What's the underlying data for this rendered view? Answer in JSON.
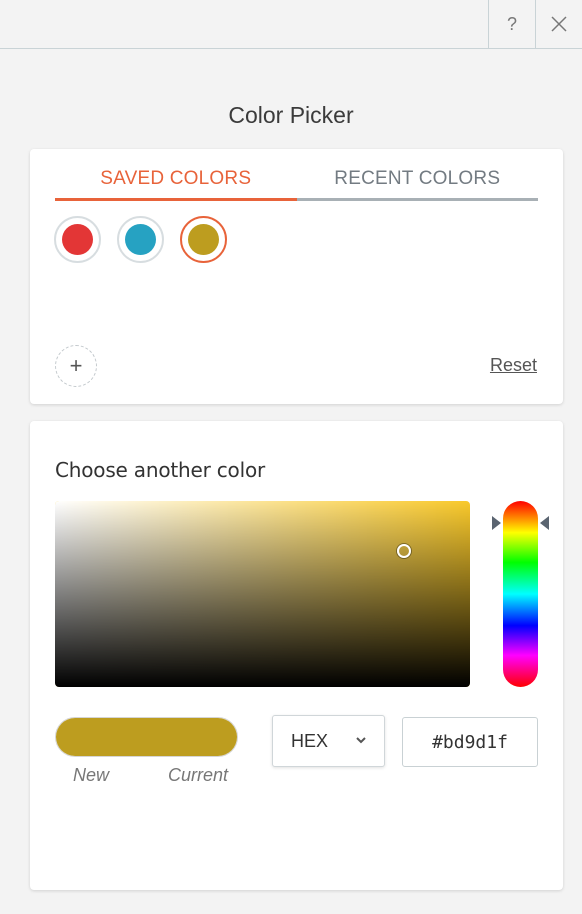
{
  "topbar": {
    "help_label": "?",
    "close_label": "×"
  },
  "title": "Color Picker",
  "saved_card": {
    "tabs": [
      {
        "label": "SAVED COLORS",
        "active": true
      },
      {
        "label": "RECENT COLORS",
        "active": false
      }
    ],
    "swatches": [
      {
        "color": "#e33636",
        "selected": false
      },
      {
        "color": "#26a2c2",
        "selected": false
      },
      {
        "color": "#bd9d1f",
        "selected": true
      }
    ],
    "add_label": "+",
    "reset_label": "Reset"
  },
  "picker_card": {
    "heading": "Choose another color",
    "hue_color": "#f9c92b",
    "preview_new_color": "#bd9d1f",
    "preview_current_color": "#bd9d1f",
    "new_label": "New",
    "current_label": "Current",
    "format": {
      "selected": "HEX"
    },
    "hex_value": "#bd9d1f"
  },
  "colors": {
    "accent": "#e8633a",
    "inactive_tab": "#737b82"
  }
}
